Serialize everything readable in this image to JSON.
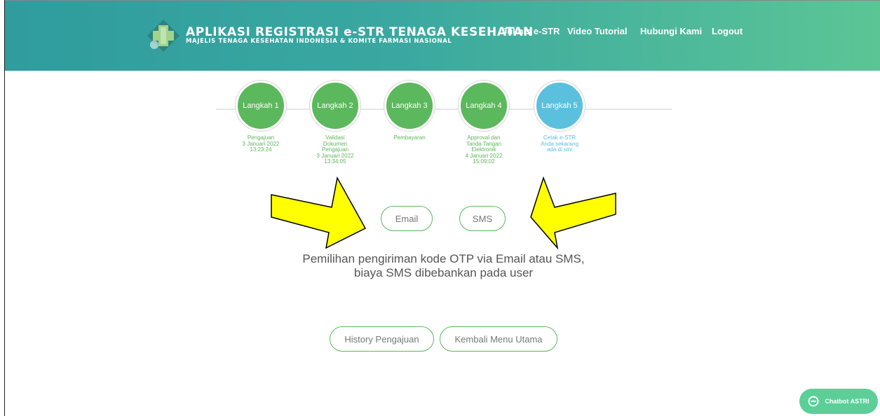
{
  "header": {
    "title": "APLIKASI REGISTRASI e-STR TENAGA KESEHATAN",
    "subtitle": "MAJELIS TENAGA KESEHATAN INDONESIA & KOMITE FARMASI NASIONAL",
    "nav": [
      {
        "label": "Juknis e-STR"
      },
      {
        "label": "Video Tutorial"
      },
      {
        "label": "Hubungi Kami"
      },
      {
        "label": "Logout"
      }
    ]
  },
  "steps": [
    {
      "label": "Langkah 1",
      "lines": [
        "Pengajuan",
        "3 Januari 2022",
        "13:23:24"
      ],
      "status": "done"
    },
    {
      "label": "Langkah 2",
      "lines": [
        "Validasi",
        "Dokumen",
        "Pengajuan",
        "3 Januari 2022",
        "13:34:05"
      ],
      "status": "done"
    },
    {
      "label": "Langkah 3",
      "lines": [
        "Pembayaran"
      ],
      "status": "done"
    },
    {
      "label": "Langkah 4",
      "lines": [
        "Approval dan",
        "Tanda Tangan",
        "Elektronik",
        "4 Januari 2022",
        "15:09:02"
      ],
      "status": "done"
    },
    {
      "label": "Langkah 5",
      "lines": [
        "Cetak e-STR",
        "Anda sekarang",
        "ada di sini"
      ],
      "status": "active"
    }
  ],
  "otp": {
    "email_label": "Email",
    "sms_label": "SMS",
    "info_line1": "Pemilihan pengiriman kode OTP via Email atau SMS,",
    "info_line2": "biaya SMS dibebankan pada user"
  },
  "actions": {
    "history_label": "History Pengajuan",
    "back_label": "Kembali Menu Utama"
  },
  "chatbot": {
    "label": "Chatbot ASTRI",
    "icon": "chat-icon"
  },
  "colors": {
    "header_start": "#2f9c9e",
    "header_end": "#5cc596",
    "step_done": "#5cb85c",
    "step_active": "#5bc0de",
    "arrow_fill": "#ffff00",
    "chatbot": "#5ccf98"
  }
}
